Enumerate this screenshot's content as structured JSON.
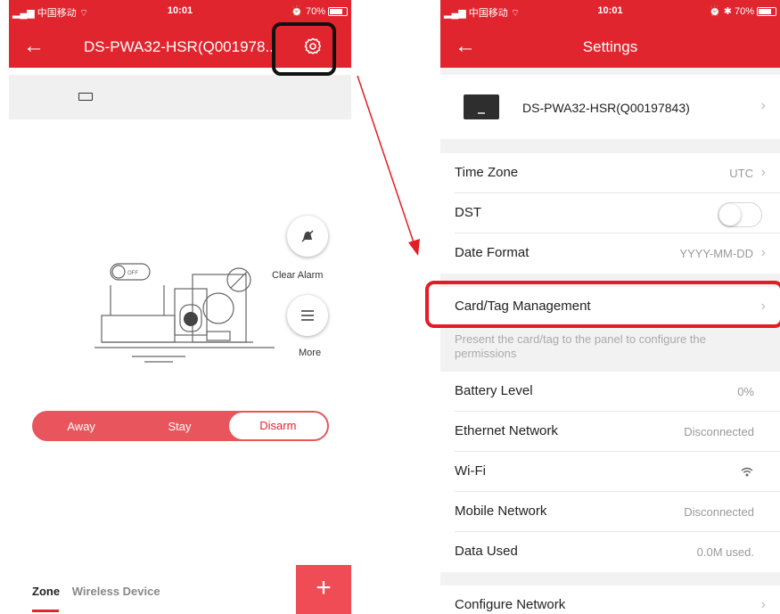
{
  "status": {
    "carrier": "中国移动",
    "time": "10:01",
    "battery": "70%"
  },
  "left": {
    "title": "DS-PWA32-HSR(Q001978..",
    "clear_alarm_label": "Clear Alarm",
    "more_label": "More",
    "off_label": "OFF",
    "modes": [
      "Away",
      "Stay",
      "Disarm"
    ],
    "selected_mode": "Disarm",
    "tab_zone": "Zone",
    "tab_wireless": "Wireless Device",
    "add_label": "+"
  },
  "right": {
    "title": "Settings",
    "device_name": "DS-PWA32-HSR(Q00197843)",
    "rows": {
      "time_zone": {
        "label": "Time Zone",
        "value": "UTC"
      },
      "dst": {
        "label": "DST",
        "on": false
      },
      "date_format": {
        "label": "Date Format",
        "value": "YYYY-MM-DD"
      },
      "card_tag": {
        "label": "Card/Tag Management"
      },
      "card_tag_hint": "Present the card/tag to the panel to configure the permissions",
      "battery_level": {
        "label": "Battery Level",
        "value": "0%"
      },
      "ethernet": {
        "label": "Ethernet Network",
        "value": "Disconnected"
      },
      "wifi": {
        "label": "Wi-Fi",
        "icon": "wifi-icon"
      },
      "mobile": {
        "label": "Mobile Network",
        "value": "Disconnected"
      },
      "data_used": {
        "label": "Data Used",
        "value": "0.0M used."
      },
      "configure_network": {
        "label": "Configure Network"
      }
    }
  },
  "colors": {
    "brand_red": "#e0252e",
    "highlight_red": "#e41c24"
  }
}
